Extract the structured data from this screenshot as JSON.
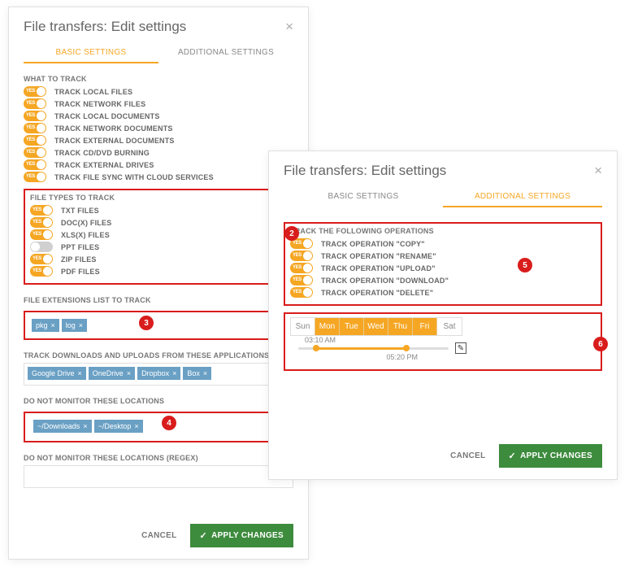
{
  "leftDialog": {
    "title": "File transfers: Edit settings",
    "tabs": {
      "basic": "BASIC SETTINGS",
      "additional": "ADDITIONAL SETTINGS"
    },
    "sections": {
      "whatToTrack": {
        "label": "WHAT TO TRACK",
        "items": [
          "TRACK LOCAL FILES",
          "TRACK NETWORK FILES",
          "TRACK LOCAL DOCUMENTS",
          "TRACK NETWORK DOCUMENTS",
          "TRACK EXTERNAL DOCUMENTS",
          "TRACK CD/DVD BURNING",
          "TRACK EXTERNAL DRIVES",
          "TRACK FILE SYNC WITH CLOUD SERVICES"
        ]
      },
      "fileTypes": {
        "label": "FILE TYPES TO TRACK",
        "items": [
          {
            "label": "TXT FILES",
            "on": true
          },
          {
            "label": "DOC(X) FILES",
            "on": true
          },
          {
            "label": "XLS(X) FILES",
            "on": true
          },
          {
            "label": "PPT FILES",
            "on": false
          },
          {
            "label": "ZIP FILES",
            "on": true
          },
          {
            "label": "PDF FILES",
            "on": true
          }
        ]
      },
      "extensions": {
        "label": "FILE EXTENSIONS LIST TO TRACK",
        "tags": [
          "pkg",
          "log"
        ]
      },
      "cloudApps": {
        "label": "TRACK DOWNLOADS AND UPLOADS FROM THESE APPLICATIONS",
        "tags": [
          "Google Drive",
          "OneDrive",
          "Dropbox",
          "Box"
        ]
      },
      "excludeLoc": {
        "label": "DO NOT MONITOR THESE LOCATIONS",
        "tags": [
          "~/Downloads",
          "~/Desktop"
        ]
      },
      "excludeRegex": {
        "label": "DO NOT MONITOR THESE LOCATIONS (REGEX)"
      }
    },
    "footer": {
      "cancel": "CANCEL",
      "apply": "APPLY CHANGES"
    }
  },
  "rightDialog": {
    "title": "File transfers: Edit settings",
    "tabs": {
      "basic": "BASIC SETTINGS",
      "additional": "ADDITIONAL SETTINGS"
    },
    "operations": {
      "label": "TRACK THE FOLLOWING OPERATIONS",
      "items": [
        "TRACK OPERATION \"COPY\"",
        "TRACK OPERATION \"RENAME\"",
        "TRACK OPERATION \"UPLOAD\"",
        "TRACK OPERATION \"DOWNLOAD\"",
        "TRACK OPERATION \"DELETE\""
      ]
    },
    "schedule": {
      "days": [
        {
          "label": "Sun",
          "on": false
        },
        {
          "label": "Mon",
          "on": true
        },
        {
          "label": "Tue",
          "on": true
        },
        {
          "label": "Wed",
          "on": true
        },
        {
          "label": "Thu",
          "on": true
        },
        {
          "label": "Fri",
          "on": true
        },
        {
          "label": "Sat",
          "on": false
        }
      ],
      "start": "03:10 AM",
      "end": "05:20 PM"
    },
    "footer": {
      "cancel": "CANCEL",
      "apply": "APPLY CHANGES"
    }
  },
  "toggleYes": "YES",
  "annotations": {
    "n2": "2",
    "n3": "3",
    "n4": "4",
    "n5": "5",
    "n6": "6"
  }
}
